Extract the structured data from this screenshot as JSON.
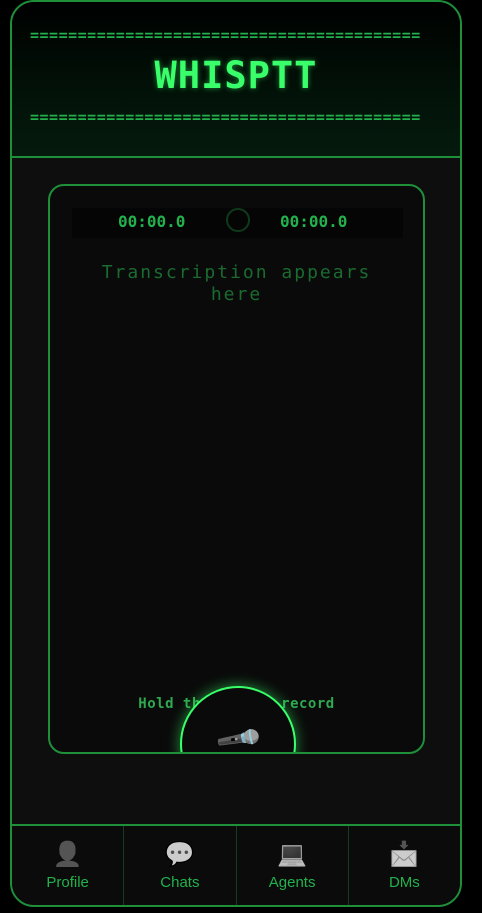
{
  "header": {
    "title": "WHISPTT",
    "divider": "========================================="
  },
  "timers": {
    "elapsed": "00:00.0",
    "total": "00:00.0"
  },
  "transcript": {
    "placeholder": "Transcription appears here"
  },
  "record": {
    "hint": "Hold the mic to record"
  },
  "nav": {
    "items": [
      {
        "label": "Profile",
        "icon": "profile-icon"
      },
      {
        "label": "Chats",
        "icon": "chat-bubble-icon"
      },
      {
        "label": "Agents",
        "icon": "laptop-icon"
      },
      {
        "label": "DMs",
        "icon": "inbox-icon"
      }
    ]
  },
  "colors": {
    "accent": "#39ff6a",
    "border": "#1f8f3a",
    "text_dim": "#1a6b30",
    "background": "#0b0b0b"
  }
}
